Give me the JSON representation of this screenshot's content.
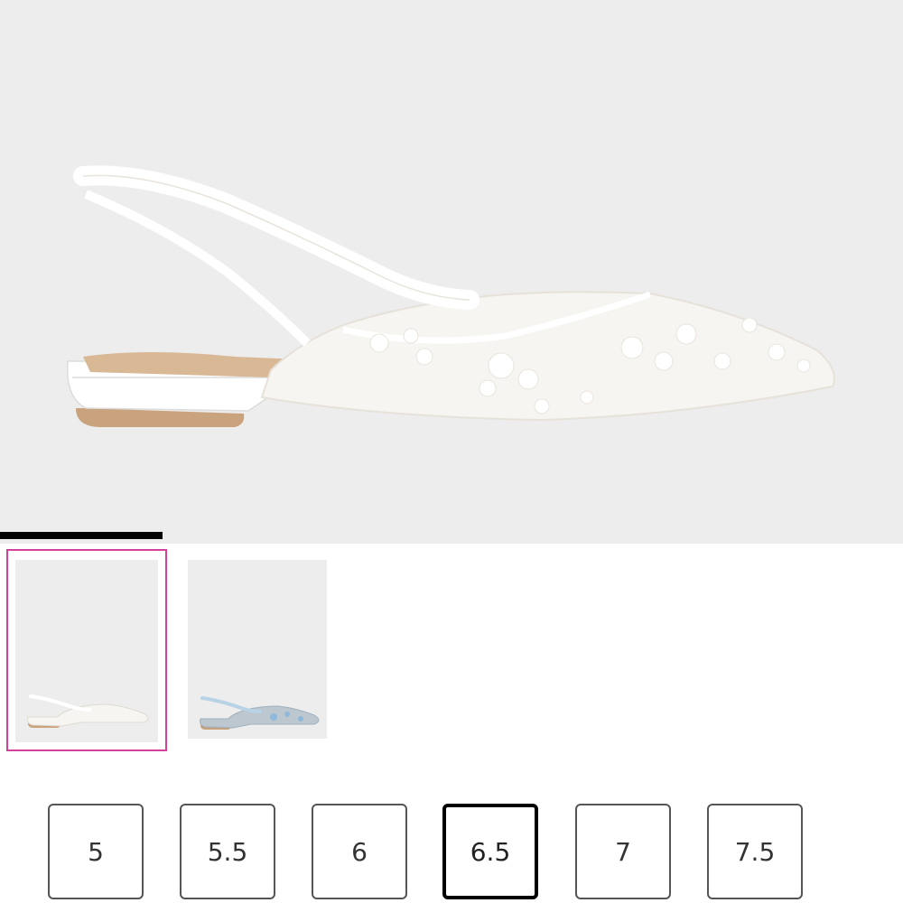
{
  "product": {
    "main_image": "white-lace-pointed-slingback-flat",
    "image_progress": 0.18
  },
  "thumbnails": [
    {
      "image": "white-lace-slingback-flat-thumbnail",
      "selected": true
    },
    {
      "image": "blue-embroidered-slingback-flat-thumbnail",
      "selected": false
    }
  ],
  "sizes": {
    "options": [
      "5",
      "5.5",
      "6",
      "6.5",
      "7",
      "7.5"
    ],
    "selected": "6.5"
  },
  "colors": {
    "accent": "#d4419b",
    "hero_bg": "#ededed",
    "progress": "#000000"
  }
}
